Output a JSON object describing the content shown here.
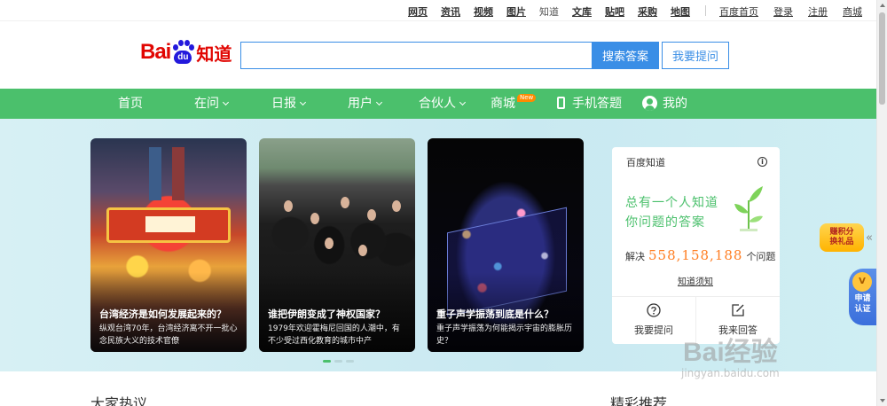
{
  "topbar": {
    "links": [
      "网页",
      "资讯",
      "视频",
      "图片",
      "知道",
      "文库",
      "贴吧",
      "采购",
      "地图"
    ],
    "right_links": [
      "百度首页",
      "登录",
      "注册",
      "商城"
    ]
  },
  "header": {
    "logo": {
      "text_bai": "Bai",
      "text_du": "du",
      "text_zhidao": "知道"
    },
    "search": {
      "value": "",
      "placeholder": ""
    },
    "search_button": "搜索答案",
    "ask_button": "我要提问"
  },
  "nav": {
    "items": [
      {
        "label": "首页",
        "dropdown": false
      },
      {
        "label": "在问",
        "dropdown": true
      },
      {
        "label": "日报",
        "dropdown": true
      },
      {
        "label": "用户",
        "dropdown": true
      },
      {
        "label": "合伙人",
        "dropdown": true
      },
      {
        "label": "商城",
        "badge": "New"
      },
      {
        "label": "手机答题",
        "icon": "phone-icon"
      },
      {
        "label": "我的",
        "icon": "user-icon"
      }
    ]
  },
  "cards": [
    {
      "title": "台湾经济是如何发展起来的？",
      "desc": "纵观台湾70年，台湾经济离不开一批心念民族大义的技术官僚"
    },
    {
      "title": "谁把伊朗变成了神权国家？",
      "desc": "1979年欢迎霍梅尼回国的人潮中，有不少受过西化教育的城市中产"
    },
    {
      "title": "重子声学振荡到底是什么？",
      "desc": "重子声学振荡为何能揭示宇宙的膨胀历史？"
    }
  ],
  "carousel": {
    "count": 3,
    "active": 0
  },
  "panel": {
    "title": "百度知道",
    "slogan_line1": "总有一个人知道",
    "slogan_line2": "你问题的答案",
    "solved_prefix": "解决",
    "solved_count": "558,158,188",
    "solved_suffix": "个问题",
    "guide": "知道须知",
    "ask_label": "我要提问",
    "answer_label": "我来回答"
  },
  "float": {
    "points_line1": "赚积分",
    "points_line2": "换礼品",
    "cert_line1": "申请",
    "cert_line2": "认证",
    "cert_medal": "V"
  },
  "sections": {
    "left": "大家热议",
    "right": "精彩推荐"
  },
  "watermark": {
    "big": "Bai经验",
    "small": "jingyan.baidu.com"
  },
  "colors": {
    "brand_green": "#4bc06c",
    "search_blue": "#3a8ee6",
    "logo_red": "#e10602",
    "accent_orange": "#ff7f24"
  }
}
